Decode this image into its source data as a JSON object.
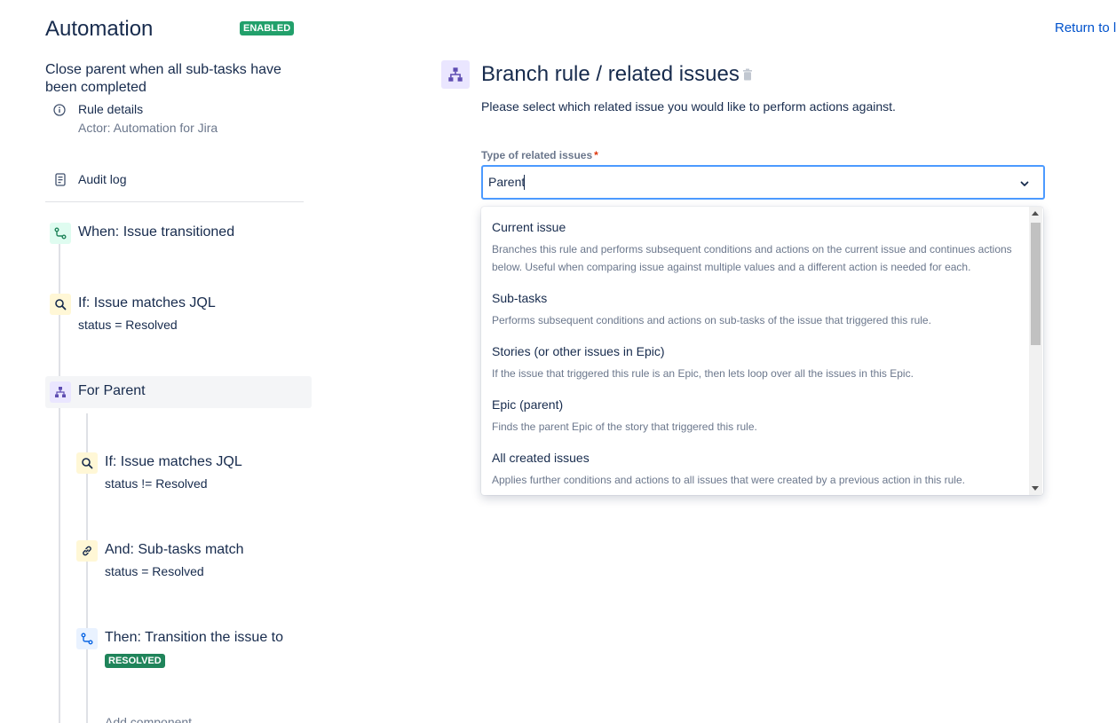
{
  "header": {
    "title": "Automation",
    "status_badge": "ENABLED",
    "return_link": "Return to li"
  },
  "rule": {
    "name": "Close parent when all sub-tasks have been completed",
    "details_label": "Rule details",
    "actor": "Actor: Automation for Jira",
    "audit_label": "Audit log"
  },
  "steps": {
    "trigger": {
      "title": "When: Issue transitioned"
    },
    "condition1": {
      "title": "If: Issue matches JQL",
      "sub": "status = Resolved"
    },
    "branch": {
      "title": "For Parent"
    },
    "condition2": {
      "title": "If: Issue matches JQL",
      "sub": "status != Resolved"
    },
    "condition3": {
      "title": "And: Sub-tasks match",
      "sub": "status = Resolved"
    },
    "action": {
      "title": "Then: Transition the issue to",
      "badge": "RESOLVED"
    },
    "add_component": "Add component"
  },
  "panel": {
    "title": "Branch rule / related issues",
    "description": "Please select which related issue you would like to perform actions against.",
    "field_label": "Type of related issues",
    "required_mark": "*",
    "selected_value": "Parent",
    "options": [
      {
        "title": "Current issue",
        "desc": "Branches this rule and performs subsequent conditions and actions on the current issue and continues actions below. Useful when comparing issue against multiple values and a different action is needed for each."
      },
      {
        "title": "Sub-tasks",
        "desc": "Performs subsequent conditions and actions on sub-tasks of the issue that triggered this rule."
      },
      {
        "title": "Stories (or other issues in Epic)",
        "desc": "If the issue that triggered this rule is an Epic, then lets loop over all the issues in this Epic."
      },
      {
        "title": "Epic (parent)",
        "desc": "Finds the parent Epic of the story that triggered this rule."
      },
      {
        "title": "All created issues",
        "desc": "Applies further conditions and actions to all issues that were created by a previous action in this rule."
      }
    ]
  },
  "colors": {
    "accent": "#0052cc",
    "badge_green": "#1f845a",
    "focus_border": "#4c9aff",
    "selected_bg": "#f4f5f7"
  }
}
